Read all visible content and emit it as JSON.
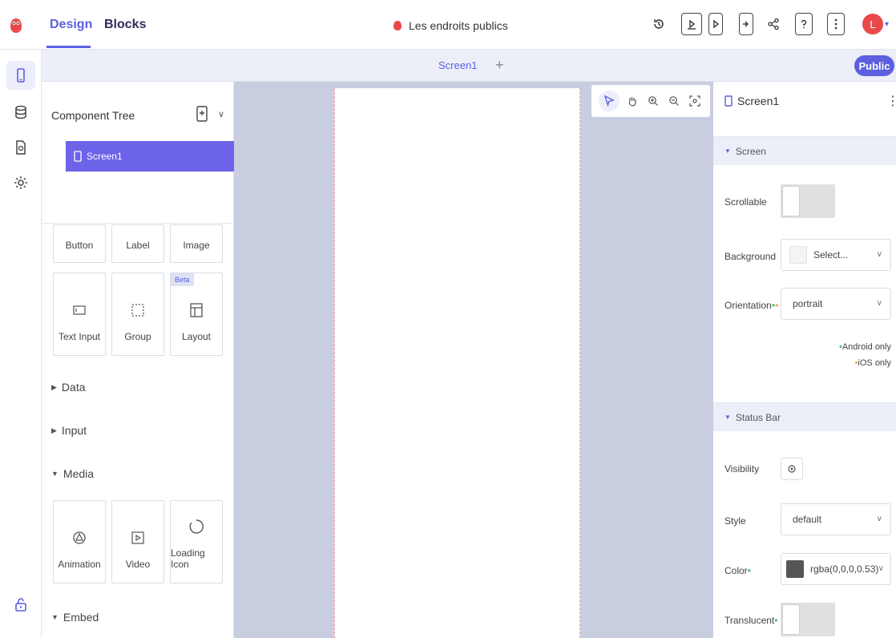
{
  "header": {
    "tab_design": "Design",
    "tab_blocks": "Blocks",
    "project_name": "Les endroits publics",
    "avatar_letter": "L"
  },
  "screenbar": {
    "screen_tab": "Screen1",
    "add_symbol": "+",
    "public_label": "Public"
  },
  "component_tree": {
    "title": "Component Tree",
    "screen_item": "Screen1"
  },
  "palette": {
    "row1": [
      "Button",
      "Label",
      "Image"
    ],
    "row2": [
      "Text Input",
      "Group",
      "Layout"
    ],
    "beta_badge": "Beta",
    "categories": [
      "Data",
      "Input",
      "Media",
      "Embed"
    ],
    "media": [
      "Animation",
      "Video",
      "Loading Icon"
    ]
  },
  "properties": {
    "title": "Screen1",
    "section_screen": "Screen",
    "scrollable_label": "Scrollable",
    "background_label": "Background",
    "background_value": "Select...",
    "orientation_label": "Orientation",
    "orientation_value": "portrait",
    "android_only": "Android only",
    "ios_only": "iOS only",
    "section_status": "Status Bar",
    "visibility_label": "Visibility",
    "style_label": "Style",
    "style_value": "default",
    "color_label": "Color",
    "color_value": "rgba(0,0,0,0.53)",
    "translucent_label": "Translucent"
  },
  "colors": {
    "accent": "#5b5fe0",
    "selected_tree": "#6c63e8",
    "canvas_bg": "#c9cde0",
    "android_dot": "#3dbb6a",
    "ios_dot": "#f0a830"
  }
}
